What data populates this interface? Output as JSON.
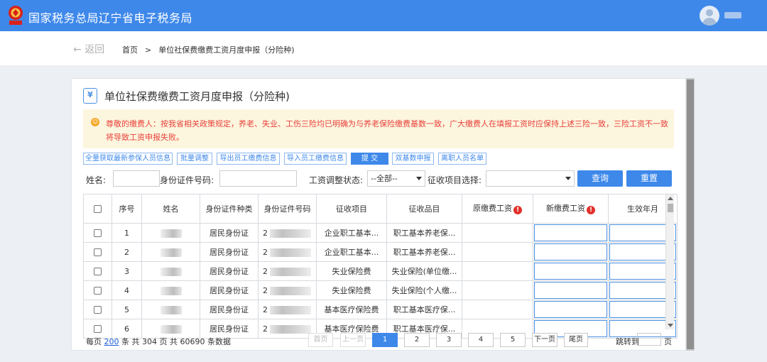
{
  "app": {
    "title": "国家税务总局辽宁省电子税务局"
  },
  "nav": {
    "back_label": "返回",
    "breadcrumb": [
      "首页",
      "单位社保费缴费工资月度申报（分险种)"
    ],
    "separator": ">"
  },
  "page": {
    "title": "单位社保费缴费工资月度申报（分险种)"
  },
  "notice": {
    "text": "尊敬的缴费人：按我省相关政策规定，养老、失业、工伤三险均已明确为与养老保险缴费基数一致，广大缴费人在填报工资时应保持上述三险一致，三险工资不一致将导致工资申报失败。"
  },
  "toolbar": {
    "buttons": [
      "全量获取最新参保人员信息",
      "批量调整",
      "导出员工缴费信息",
      "导入员工缴费信息",
      "提 交",
      "双基数申报",
      "离职人员名单"
    ]
  },
  "filter": {
    "name_label": "姓名:",
    "id_label": "身份证件号码:",
    "status_label": "工资调整状态:",
    "status_value": "--全部--",
    "item_label": "征收项目选择:",
    "item_value": "",
    "search_label": "查询",
    "reset_label": "重置"
  },
  "table": {
    "headers": [
      "序号",
      "姓名",
      "身份证件种类",
      "身份证件号码",
      "征收项目",
      "征收品目",
      "原缴费工资",
      "新缴费工资",
      "生效年月"
    ],
    "rows": [
      {
        "seq": "1",
        "id_type": "居民身份证",
        "id_prefix": "2",
        "item": "企业职工基本...",
        "subitem": "职工基本养老保..."
      },
      {
        "seq": "2",
        "id_type": "居民身份证",
        "id_prefix": "2",
        "item": "企业职工基本...",
        "subitem": "职工基本养老保..."
      },
      {
        "seq": "3",
        "id_type": "居民身份证",
        "id_prefix": "2",
        "item": "失业保险费",
        "subitem": "失业保险(单位缴..."
      },
      {
        "seq": "4",
        "id_type": "居民身份证",
        "id_prefix": "2",
        "item": "失业保险费",
        "subitem": "失业保险(个人缴..."
      },
      {
        "seq": "5",
        "id_type": "居民身份证",
        "id_prefix": "2",
        "item": "基本医疗保险费",
        "subitem": "职工基本医疗保..."
      },
      {
        "seq": "6",
        "id_type": "居民身份证",
        "id_prefix": "2",
        "item": "基本医疗保险费",
        "subitem": "职工基本医疗保..."
      }
    ]
  },
  "pagination": {
    "per_page_prefix": "每页",
    "per_page": "200",
    "summary": "条 共 304 页   共 60690 条数据",
    "first": "首页",
    "prev": "上一页",
    "pages": [
      "1",
      "2",
      "3",
      "4",
      "5"
    ],
    "current_page": "1",
    "next": "下一页",
    "last": "尾页",
    "jump_label": "跳转到",
    "jump_unit": "页"
  }
}
